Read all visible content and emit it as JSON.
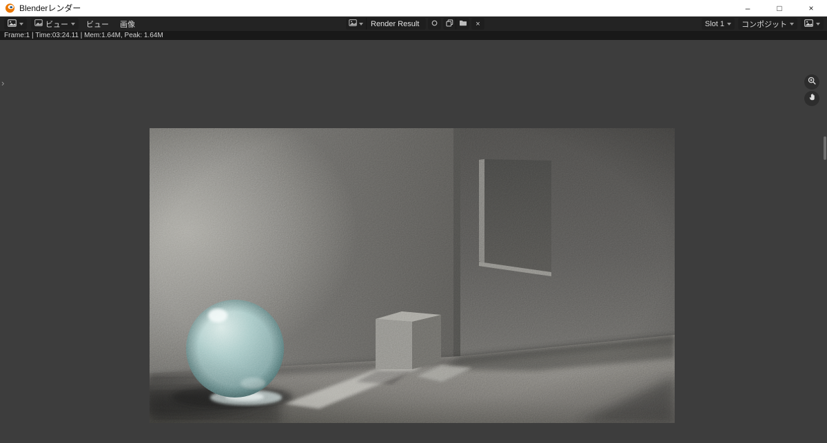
{
  "window": {
    "title": "Blenderレンダー",
    "controls": {
      "minimize": "–",
      "maximize": "□",
      "close": "×"
    }
  },
  "header": {
    "mode_dropdown": {
      "label": "ビュー"
    },
    "menus": {
      "view": "ビュー",
      "image": "画像"
    },
    "image_block": {
      "name": "Render Result"
    },
    "slot_dropdown": {
      "label": "Slot 1"
    },
    "pass_dropdown": {
      "label": "コンポジット"
    },
    "unlink_glyph": "×"
  },
  "statusbar": {
    "render_stats": "Frame:1 | Time:03:24.11 | Mem:1.64M, Peak: 1.64M"
  },
  "viewport": {
    "region_expand_glyph": "›"
  },
  "icons": [
    "blender-logo-icon",
    "editor-type-icon",
    "mode-image-icon",
    "menu-carets",
    "browse-image-icon",
    "pin-icon",
    "new-image-icon",
    "open-image-icon",
    "unlink-icon",
    "slot-caret",
    "pass-caret",
    "display-channels-icon",
    "zoom-icon",
    "pan-hand-icon",
    "region-expand-icon"
  ],
  "scene": {
    "description": "Rendered gray room: glossy teal sphere at left, small gray cube at center, dark window opening on right wall, bright light patch on floor, grainy render noise",
    "colors": {
      "titlebar_bg": "#ffffff",
      "header_bg": "#232323",
      "statusbar_bg": "#191919",
      "viewport_bg": "#3d3d3d",
      "wall_gray": "#6b6a67",
      "right_wall_gray": "#585755",
      "window_dark": "#4c4c4a",
      "floor_light_patch": "#b2b1ab",
      "sphere_teal": "#9fc6c4"
    }
  }
}
